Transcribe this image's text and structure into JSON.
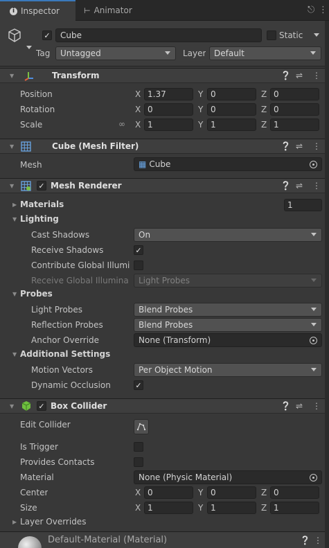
{
  "tabs": {
    "inspector": "Inspector",
    "animator": "Animator"
  },
  "gameobject": {
    "name": "Cube",
    "static_label": "Static",
    "tag_label": "Tag",
    "tag_value": "Untagged",
    "layer_label": "Layer",
    "layer_value": "Default"
  },
  "transform": {
    "title": "Transform",
    "position": {
      "label": "Position",
      "x": "1.37",
      "y": "0",
      "z": "0"
    },
    "rotation": {
      "label": "Rotation",
      "x": "0",
      "y": "0",
      "z": "0"
    },
    "scale": {
      "label": "Scale",
      "x": "1",
      "y": "1",
      "z": "1"
    }
  },
  "axis": {
    "x": "X",
    "y": "Y",
    "z": "Z"
  },
  "mesh_filter": {
    "title": "Cube (Mesh Filter)",
    "mesh_label": "Mesh",
    "mesh_value": "Cube"
  },
  "mesh_renderer": {
    "title": "Mesh Renderer",
    "materials_label": "Materials",
    "materials_count": "1",
    "lighting_label": "Lighting",
    "cast_shadows_label": "Cast Shadows",
    "cast_shadows_value": "On",
    "receive_shadows_label": "Receive Shadows",
    "contribute_gi_label": "Contribute Global Illumi",
    "receive_gi_label": "Receive Global Illumina",
    "receive_gi_value": "Light Probes",
    "probes_label": "Probes",
    "light_probes_label": "Light Probes",
    "light_probes_value": "Blend Probes",
    "reflection_probes_label": "Reflection Probes",
    "reflection_probes_value": "Blend Probes",
    "anchor_override_label": "Anchor Override",
    "anchor_override_value": "None (Transform)",
    "additional_label": "Additional Settings",
    "motion_vectors_label": "Motion Vectors",
    "motion_vectors_value": "Per Object Motion",
    "dynamic_occlusion_label": "Dynamic Occlusion"
  },
  "box_collider": {
    "title": "Box Collider",
    "edit_collider_label": "Edit Collider",
    "is_trigger_label": "Is Trigger",
    "provides_contacts_label": "Provides Contacts",
    "material_label": "Material",
    "material_value": "None (Physic Material)",
    "center": {
      "label": "Center",
      "x": "0",
      "y": "0",
      "z": "0"
    },
    "size": {
      "label": "Size",
      "x": "1",
      "y": "1",
      "z": "1"
    },
    "layer_overrides_label": "Layer Overrides"
  },
  "material_header": {
    "title": "Default-Material (Material)"
  },
  "icons": {
    "inspector": "info-icon",
    "animator": "animator-icon",
    "lock": "lock-icon",
    "menu": "kebab-menu-icon",
    "gameobject": "cube-outline-icon",
    "transform": "transform-axes-icon",
    "mesh_filter": "grid-icon",
    "mesh_renderer": "mesh-renderer-icon",
    "box_collider": "green-cube-icon",
    "help": "help-icon",
    "presets": "presets-icon",
    "target": "object-picker-icon"
  },
  "colors": {
    "background": "#383838",
    "header": "#3e3e3e",
    "field": "#2a2a2a",
    "accent": "#3a79bb"
  }
}
